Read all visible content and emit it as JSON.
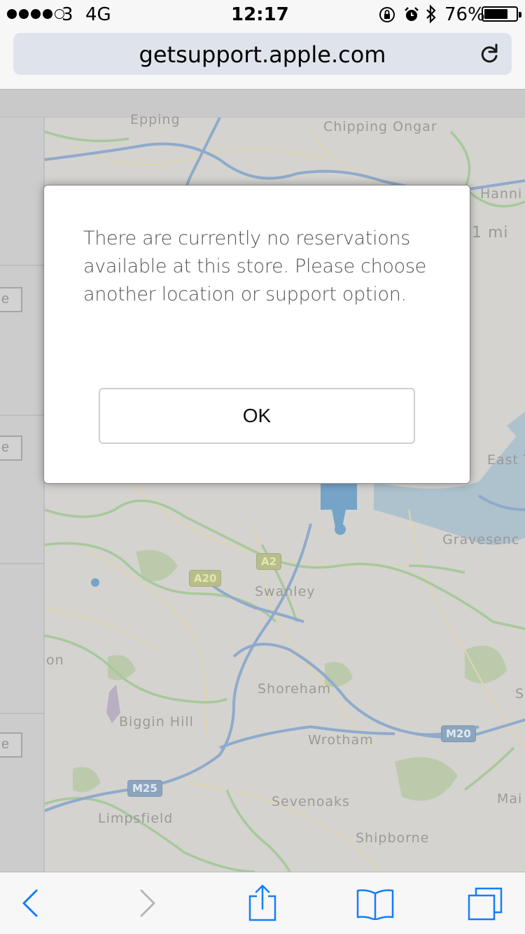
{
  "status_bar": {
    "carrier": "3",
    "network": "4G",
    "time": "12:17",
    "battery_percent": "76%",
    "battery_level": 0.76,
    "signal_bars_filled": 4,
    "icons": [
      "orientation-lock-icon",
      "alarm-icon",
      "bluetooth-icon"
    ]
  },
  "browser": {
    "url": "getsupport.apple.com",
    "reload_icon": "reload-icon"
  },
  "map": {
    "labels": {
      "epping": "Epping",
      "chipping_ongar": "Chipping Ongar",
      "hanni": "Hanni",
      "distance": "1 mi",
      "east": "East T",
      "gravesend": "Gravesenc",
      "swanley": "Swanley",
      "shoreham": "Shoreham",
      "biggin_hill": "Biggin Hill",
      "wrotham": "Wrotham",
      "sevenoaks": "Sevenoaks",
      "limpsfield": "Limpsfield",
      "shipborne": "Shipborne",
      "mai": "Mai",
      "on": "on",
      "s": "S"
    },
    "roads": {
      "a2": "A2",
      "a20": "A20",
      "m20": "M20",
      "m25": "M25"
    },
    "side_buttons": [
      "e",
      "e",
      "e"
    ]
  },
  "dialog": {
    "message": "There are currently no reservations available at this store. Please choose another location or support option.",
    "ok_label": "OK"
  },
  "toolbar": {
    "items": [
      "back-icon",
      "forward-icon",
      "share-icon",
      "bookmarks-icon",
      "tabs-icon"
    ]
  },
  "colors": {
    "accent": "#147efb",
    "disabled": "#b6b6b6",
    "road_blue": "#7fa2cc",
    "road_green": "#9ec98d"
  }
}
